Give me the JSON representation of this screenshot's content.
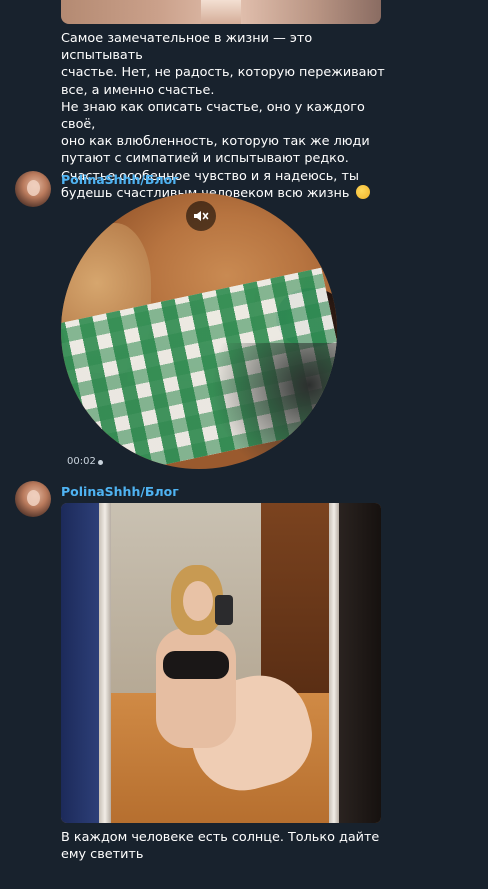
{
  "messages": [
    {
      "text": "Самое замечательное в жизни — это испытывать\nсчастье. Нет, не радость, которую переживают\nвсе, а именно счастье.\nНе знаю как описать счастье, оно у каждого своё,\nоно как влюбленность, которую так же люди\nпутают с симпатией и испытывают редко.\nСчастье особенное чувство и я надеюсь, ты\nбудешь счастливым человеком всю жизнь",
      "emoji": "smiling-face-emoji"
    },
    {
      "author": "PolinaShhh/Блог",
      "video_duration": "00:02",
      "mute_icon": "speaker-muted-icon"
    },
    {
      "author": "PolinaShhh/Блог",
      "text": "В каждом человеке есть солнце. Только дайте\nему светить"
    }
  ],
  "colors": {
    "background": "#18222d",
    "author": "#4fb3f2",
    "text": "#ffffff",
    "meta": "#c9d3dc"
  }
}
